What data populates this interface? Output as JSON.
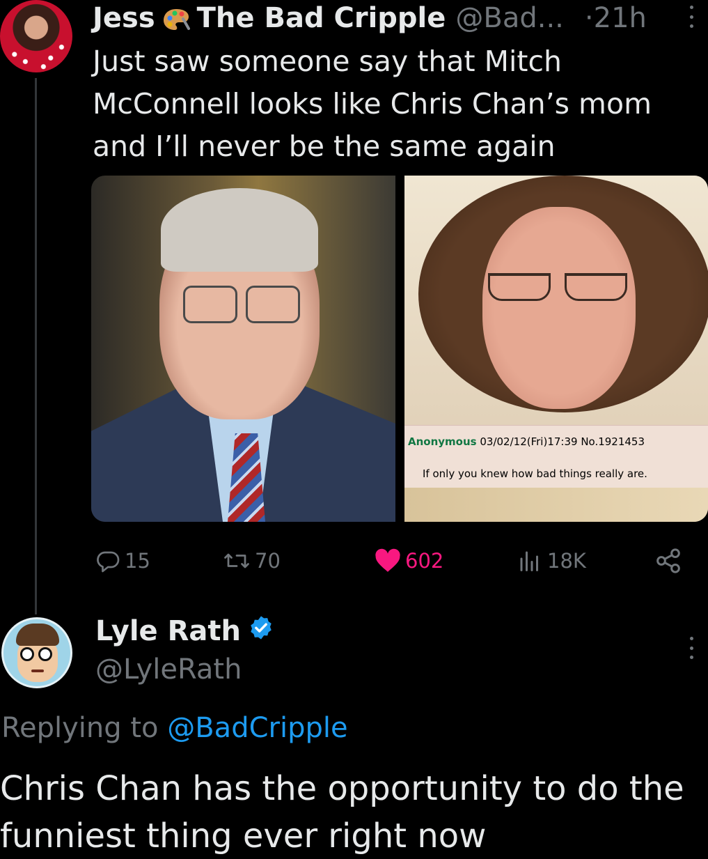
{
  "tweet": {
    "author_name": "Jess",
    "author_name_suffix": "The Bad Cripple",
    "handle": "@Bad...",
    "separator": "·",
    "time": "21h",
    "text": "Just saw someone say that Mitch McConnell looks like Chris Chan’s mom and I’ll never be the same again",
    "icons": {
      "name_emoji": "artist-palette-icon",
      "more": "more-vertical-icon"
    },
    "media": {
      "right_caption": {
        "poster": "Anonymous",
        "meta": "03/02/12(Fri)17:39 No.1921453",
        "message": "If only you knew how bad things really are."
      }
    },
    "metrics": {
      "replies": "15",
      "retweets": "70",
      "likes": "602",
      "views": "18K"
    },
    "colors": {
      "like": "#f91880",
      "muted": "#71767b",
      "accent": "#1d9bf0"
    }
  },
  "reply": {
    "author_name": "Lyle Rath",
    "verified_icon": "verified-badge-icon",
    "handle": "@LyleRath",
    "replying_prefix": "Replying to",
    "replying_to": "@BadCripple",
    "text": "Chris Chan has the opportunity to do the funniest thing ever right now"
  }
}
